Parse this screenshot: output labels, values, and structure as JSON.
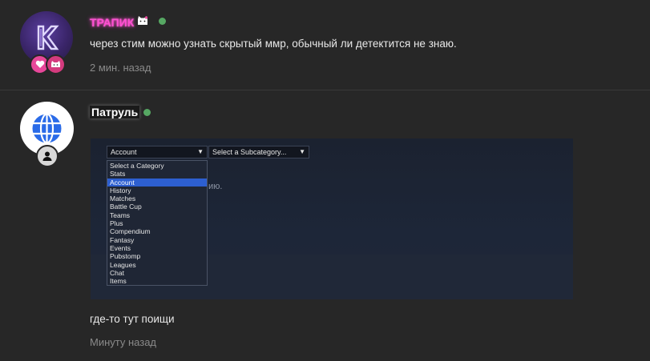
{
  "comments": [
    {
      "author": "ТРАПИК",
      "text": "через стим можно узнать скрытый ммр, обычный ли детектится не знаю.",
      "time": "2 мин. назад",
      "name_color": "#ff4fd2"
    },
    {
      "author": "Патруль",
      "text": "где-то тут поищи",
      "time": "Минуту назад",
      "screenshot": {
        "category_select": "Account",
        "subcategory_select": "Select a Subcategory...",
        "background_text": "ию.",
        "options": [
          "Select a Category",
          "Stats",
          "Account",
          "History",
          "Matches",
          "Battle Cup",
          "Teams",
          "Plus",
          "Compendium",
          "Fantasy",
          "Events",
          "Pubstomp",
          "Leagues",
          "Chat",
          "Items"
        ],
        "highlighted_option": "Account"
      }
    }
  ],
  "colors": {
    "background": "#272727",
    "online": "#56a863",
    "highlight": "#2d5fd0"
  }
}
